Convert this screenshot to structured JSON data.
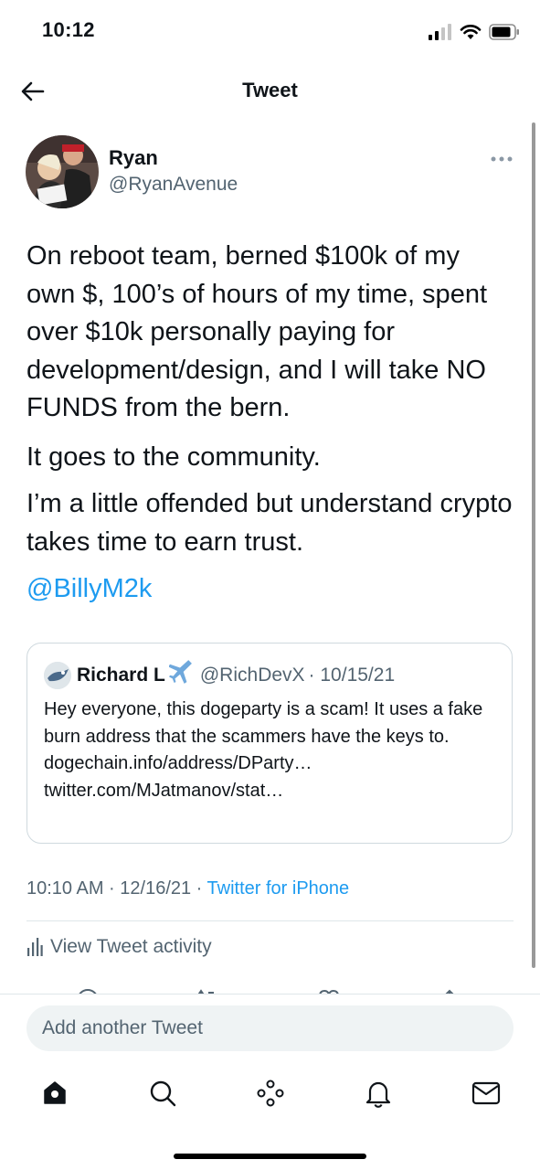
{
  "status_bar": {
    "time": "10:12"
  },
  "header": {
    "title": "Tweet"
  },
  "tweet": {
    "author_name": "Ryan",
    "author_handle": "@RyanAvenue",
    "paragraphs": [
      "On reboot team, berned $100k of my own $, 100’s of hours of my time, spent over $10k personally paying for development/design, and I will take NO FUNDS from the bern.",
      "It goes to the community.",
      "I’m a little offended but understand crypto takes time to earn trust."
    ],
    "mention": "@BillyM2k",
    "timestamp": "10:10 AM · 12/16/21 · ",
    "source": "Twitter for iPhone"
  },
  "quoted_tweet": {
    "author_name": "Richard L",
    "author_handle": "@RichDevX",
    "date": "· 10/15/21",
    "text": "Hey everyone, this dogeparty is a scam! It uses a fake burn address that the scammers have the keys to. dogechain.info/address/DParty… twitter.com/MJatmanov/stat…"
  },
  "activity": {
    "label": "View Tweet activity"
  },
  "composer": {
    "placeholder": "Add another Tweet"
  },
  "colors": {
    "accent": "#1d9bf0",
    "secondary_text": "#536471",
    "divider": "#dfe6ea"
  },
  "icons": [
    "back-arrow-icon",
    "more-icon",
    "airplane-icon",
    "activity-icon",
    "home-icon",
    "search-icon",
    "spaces-icon",
    "notifications-icon",
    "messages-icon"
  ]
}
